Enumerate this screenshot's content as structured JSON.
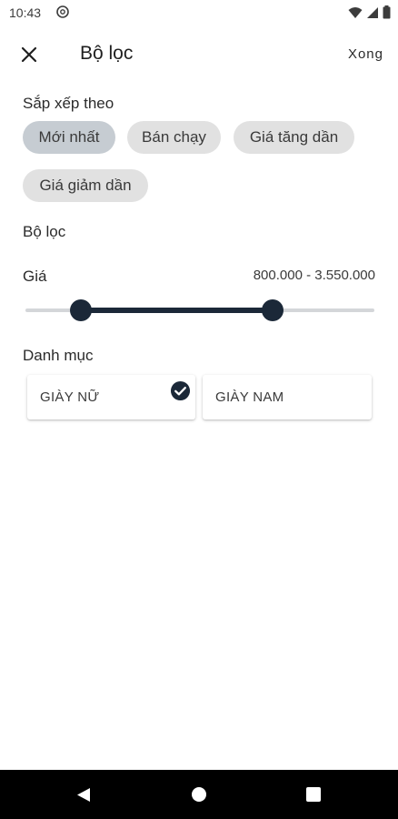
{
  "status_bar": {
    "time": "10:43"
  },
  "header": {
    "title": "Bộ lọc",
    "done_label": "Xong"
  },
  "sort": {
    "label": "Sắp xếp theo",
    "options": [
      {
        "label": "Mới nhất",
        "selected": true
      },
      {
        "label": "Bán chạy",
        "selected": false
      },
      {
        "label": "Giá tăng dần",
        "selected": false
      },
      {
        "label": "Giá giảm dần",
        "selected": false
      }
    ]
  },
  "filter": {
    "label": "Bộ lọc",
    "price": {
      "label": "Giá",
      "range_text": "800.000 - 3.550.000"
    }
  },
  "category": {
    "label": "Danh mục",
    "items": [
      {
        "label": "GIÀY NỮ",
        "checked": true
      },
      {
        "label": "GIÀY NAM",
        "checked": false
      }
    ]
  },
  "colors": {
    "accent": "#1b2838",
    "chip_bg": "#e1e1e1",
    "chip_selected_bg": "#c6ccd2"
  }
}
